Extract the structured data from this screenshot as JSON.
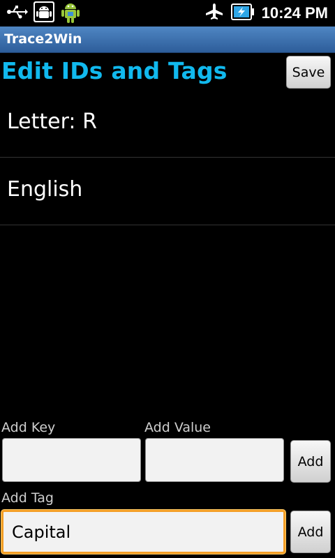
{
  "status_bar": {
    "time": "10:24 PM",
    "icons": [
      "usb-icon",
      "android-debug-icon",
      "android-market-icon",
      "airplane-mode-icon",
      "battery-charging-icon"
    ]
  },
  "app": {
    "title": "Trace2Win"
  },
  "header": {
    "title": "Edit IDs and Tags",
    "save_label": "Save"
  },
  "list": {
    "items": [
      {
        "label": "Letter: R"
      },
      {
        "label": "English"
      }
    ]
  },
  "form": {
    "add_key_label": "Add Key",
    "add_value_label": "Add Value",
    "add_key_value": "",
    "add_value_value": "",
    "add_button_label": "Add",
    "add_tag_label": "Add Tag",
    "add_tag_value": "Capital",
    "add_tag_button_label": "Add"
  },
  "colors": {
    "accent": "#11b9ee",
    "titlebar": "#3a6fb0",
    "focus": "#f39e26"
  }
}
